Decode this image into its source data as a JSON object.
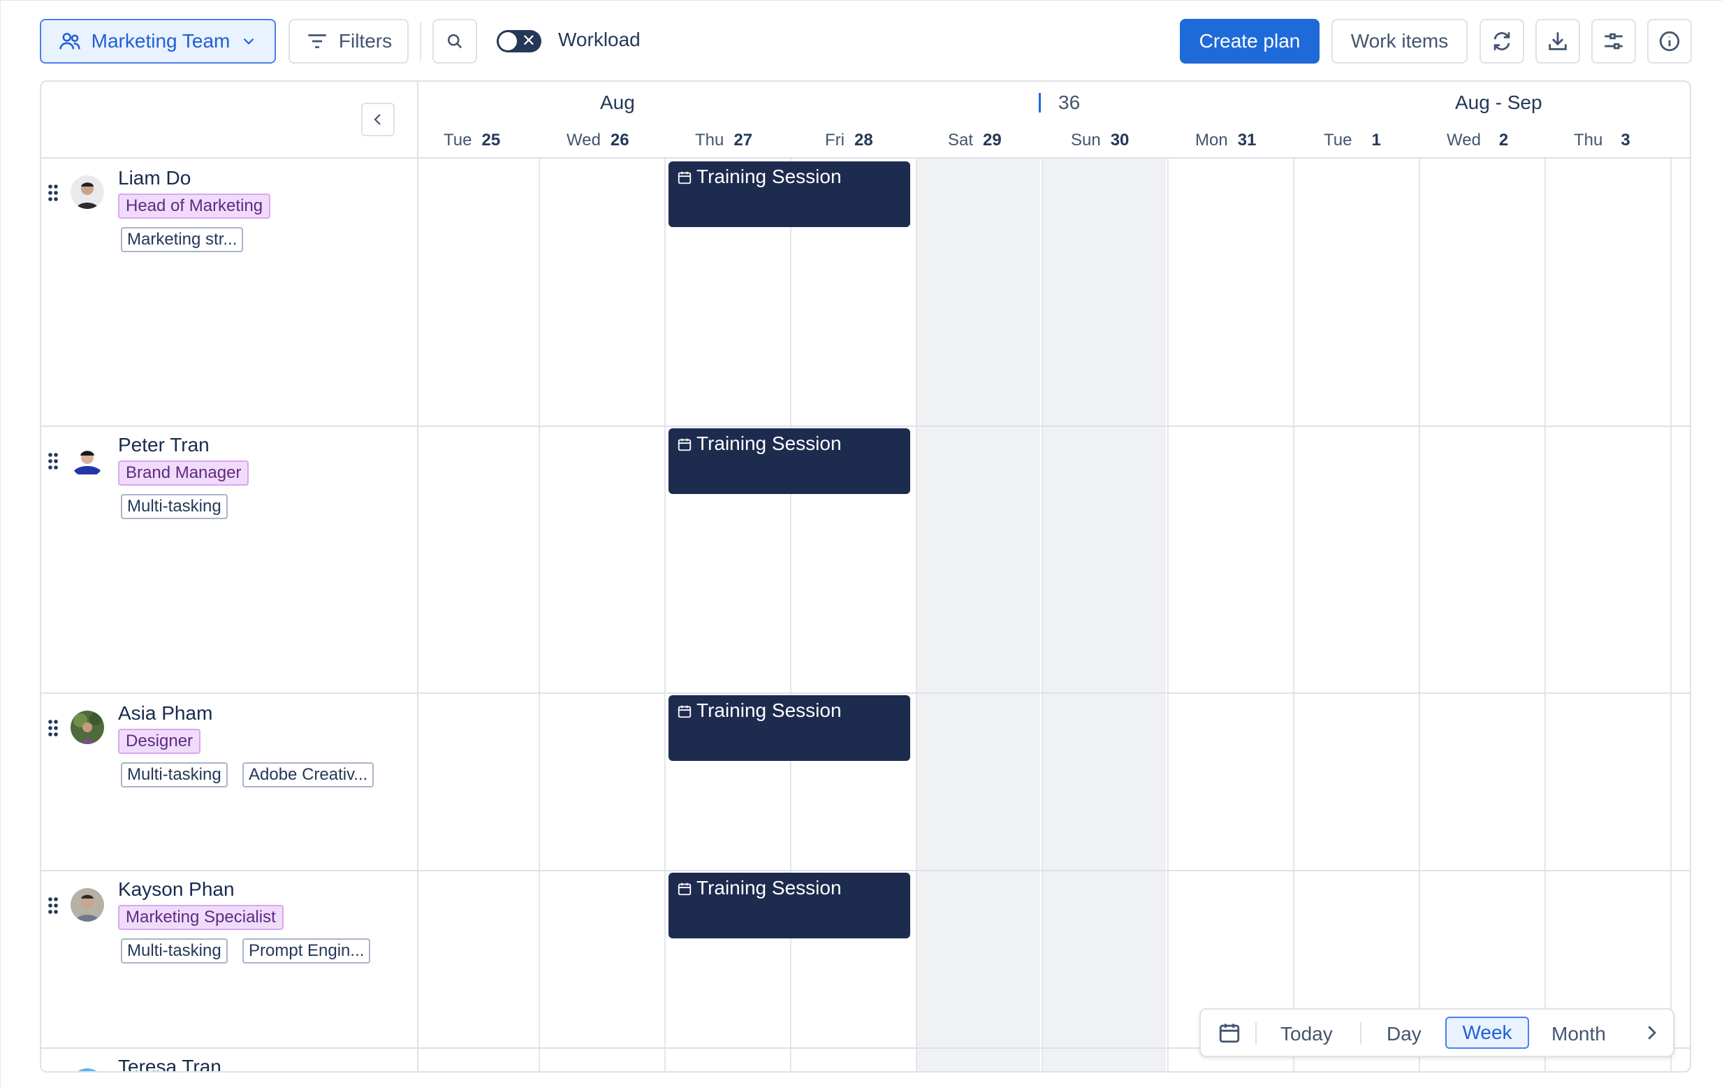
{
  "toolbar": {
    "team_label": "Marketing Team",
    "filters_label": "Filters",
    "workload_label": "Workload",
    "create_plan_label": "Create plan",
    "work_items_label": "Work items",
    "icons": [
      "refresh-icon",
      "download-icon",
      "settings-sliders-icon",
      "info-icon"
    ]
  },
  "timeline": {
    "month_labels": [
      "Aug",
      "Aug - Sep"
    ],
    "week_number": "36",
    "days": [
      {
        "dow": "Tue",
        "num": "25"
      },
      {
        "dow": "Wed",
        "num": "26"
      },
      {
        "dow": "Thu",
        "num": "27"
      },
      {
        "dow": "Fri",
        "num": "28"
      },
      {
        "dow": "Sat",
        "num": "29"
      },
      {
        "dow": "Sun",
        "num": "30"
      },
      {
        "dow": "Mon",
        "num": "31"
      },
      {
        "dow": "Tue",
        "num": "1"
      },
      {
        "dow": "Wed",
        "num": "2"
      },
      {
        "dow": "Thu",
        "num": "3"
      }
    ]
  },
  "people": [
    {
      "name": "Liam Do",
      "role": "Head of Marketing",
      "skills": [
        "Marketing str..."
      ],
      "event": "Training Session"
    },
    {
      "name": "Peter Tran",
      "role": "Brand Manager",
      "skills": [
        "Multi-tasking"
      ],
      "event": "Training Session"
    },
    {
      "name": "Asia Pham",
      "role": "Designer",
      "skills": [
        "Multi-tasking",
        "Adobe Creativ..."
      ],
      "event": "Training Session"
    },
    {
      "name": "Kayson Phan",
      "role": "Marketing Specialist",
      "skills": [
        "Multi-tasking",
        "Prompt Engin..."
      ],
      "event": "Training Session"
    },
    {
      "name": "Teresa Tran"
    }
  ],
  "view_switcher": {
    "today_label": "Today",
    "day_label": "Day",
    "week_label": "Week",
    "month_label": "Month",
    "selected": "Week"
  },
  "colors": {
    "primary": "#1f6ad9",
    "event_bg": "#1d2b4f",
    "role_bg": "#f0dcfa",
    "weekend_bg": "#f0f1f3"
  }
}
